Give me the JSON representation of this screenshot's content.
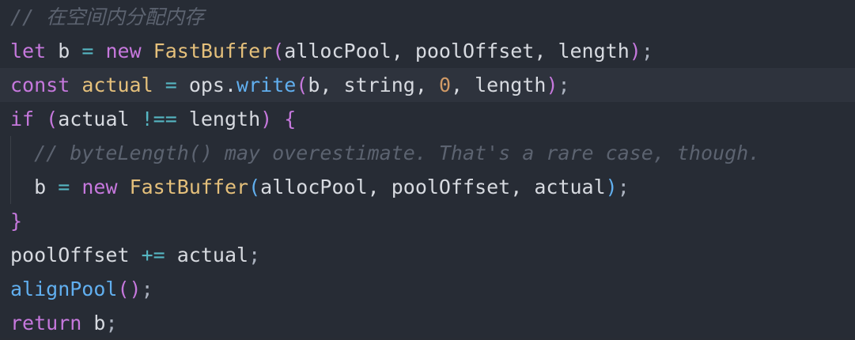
{
  "code": {
    "line1_comment": "// 在空间内分配内存",
    "line2": {
      "kw": "let",
      "name": "b",
      "op": "=",
      "new_kw": "new",
      "cls": "FastBuffer",
      "open": "(",
      "args": "allocPool, poolOffset, length",
      "close": ")",
      "end": ";"
    },
    "line3": {
      "kw": "const",
      "name": "actual",
      "op": "=",
      "obj": "ops.",
      "method": "write",
      "open": "(",
      "args_a": "b, string, ",
      "num": "0",
      "args_b": ", length",
      "close": ")",
      "end": ";"
    },
    "line4": {
      "kw": "if",
      "open": "(",
      "left": "actual",
      "op": "!==",
      "right": "length",
      "close": ")",
      "brace": "{"
    },
    "line5_comment": "// byteLength() may overestimate. That's a rare case, though.",
    "line6": {
      "name": "b",
      "op": "=",
      "new_kw": "new",
      "cls": "FastBuffer",
      "open": "(",
      "args": "allocPool, poolOffset, actual",
      "close": ")",
      "end": ";"
    },
    "line7_brace": "}",
    "line8": {
      "name": "poolOffset",
      "op": "+=",
      "value": "actual",
      "end": ";"
    },
    "line9": {
      "func": "alignPool",
      "parens": "()",
      "end": ";"
    },
    "line10": {
      "kw": "return",
      "value": "b",
      "end": ";"
    }
  }
}
